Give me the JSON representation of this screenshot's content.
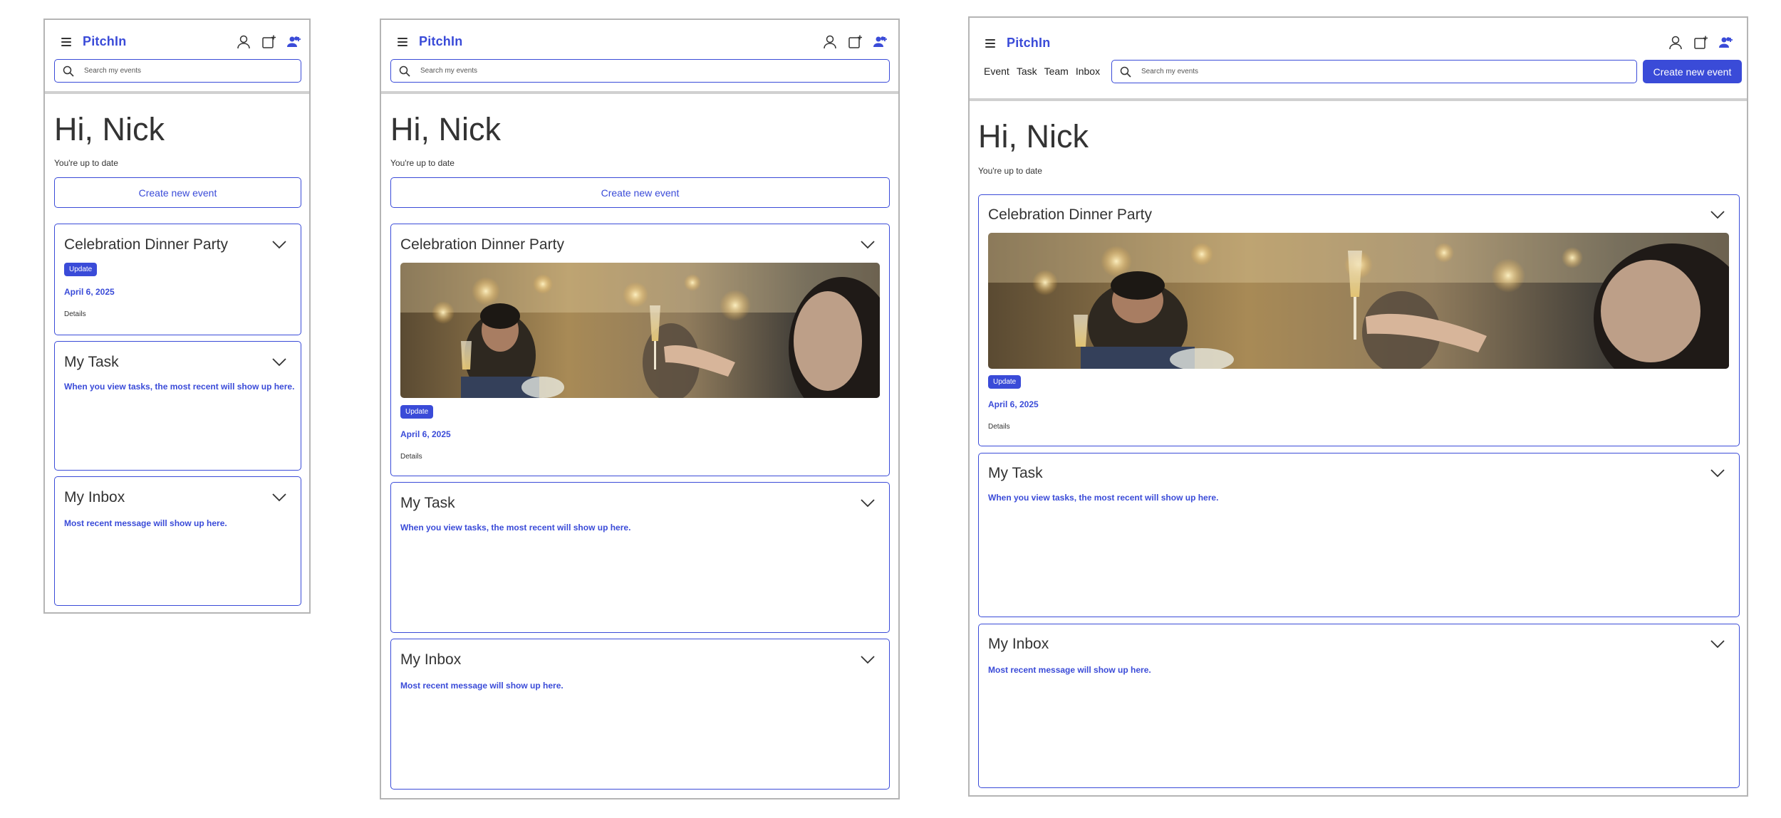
{
  "app": {
    "logo_text": "PitchIn",
    "logo_colors": {
      "text": "#3a4bd8",
      "accent_dot": "#f0c000"
    }
  },
  "header": {
    "icons": [
      "profile-icon",
      "add-event-icon",
      "team-add-icon"
    ],
    "search_placeholder": "Search my events",
    "nav": [
      "Event",
      "Task",
      "Team",
      "Inbox"
    ],
    "create_button": "Create new event"
  },
  "main": {
    "greeting": "Hi, Nick",
    "status": "You're up to date",
    "create_button": "Create new event"
  },
  "event_card": {
    "title": "Celebration Dinner Party",
    "badge": "Update",
    "date": "April 6, 2025",
    "details_link": "Details"
  },
  "task_card": {
    "title": "My Task",
    "hint": "When you view tasks, the most recent will show up here."
  },
  "inbox_card": {
    "title": "My Inbox",
    "hint": "Most recent message will show up here."
  },
  "colors": {
    "primary": "#3a4bd8",
    "text": "#333333",
    "frame_border": "#b5b5b5",
    "divider": "#d0d0d0"
  }
}
